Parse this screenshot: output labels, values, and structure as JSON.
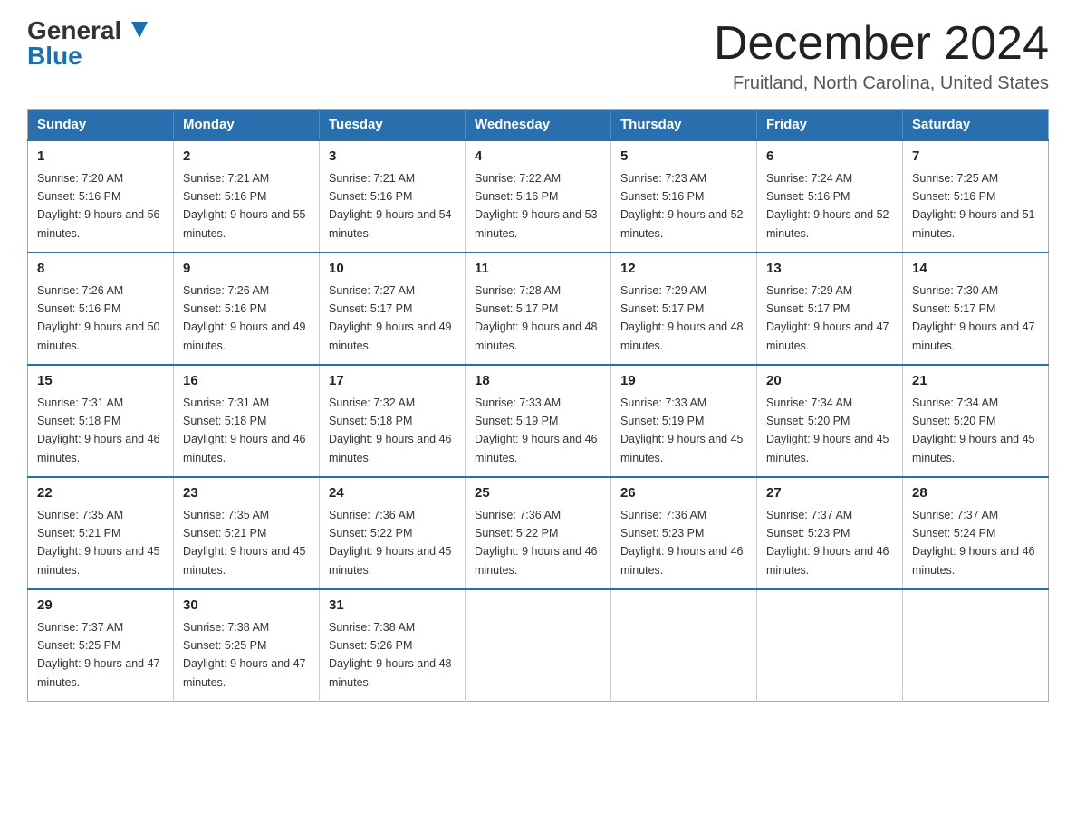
{
  "header": {
    "logo": {
      "general": "General",
      "blue": "Blue",
      "arrow": true
    },
    "title": "December 2024",
    "subtitle": "Fruitland, North Carolina, United States"
  },
  "calendar": {
    "days_of_week": [
      "Sunday",
      "Monday",
      "Tuesday",
      "Wednesday",
      "Thursday",
      "Friday",
      "Saturday"
    ],
    "weeks": [
      [
        {
          "day": "1",
          "sunrise": "7:20 AM",
          "sunset": "5:16 PM",
          "daylight": "9 hours and 56 minutes."
        },
        {
          "day": "2",
          "sunrise": "7:21 AM",
          "sunset": "5:16 PM",
          "daylight": "9 hours and 55 minutes."
        },
        {
          "day": "3",
          "sunrise": "7:21 AM",
          "sunset": "5:16 PM",
          "daylight": "9 hours and 54 minutes."
        },
        {
          "day": "4",
          "sunrise": "7:22 AM",
          "sunset": "5:16 PM",
          "daylight": "9 hours and 53 minutes."
        },
        {
          "day": "5",
          "sunrise": "7:23 AM",
          "sunset": "5:16 PM",
          "daylight": "9 hours and 52 minutes."
        },
        {
          "day": "6",
          "sunrise": "7:24 AM",
          "sunset": "5:16 PM",
          "daylight": "9 hours and 52 minutes."
        },
        {
          "day": "7",
          "sunrise": "7:25 AM",
          "sunset": "5:16 PM",
          "daylight": "9 hours and 51 minutes."
        }
      ],
      [
        {
          "day": "8",
          "sunrise": "7:26 AM",
          "sunset": "5:16 PM",
          "daylight": "9 hours and 50 minutes."
        },
        {
          "day": "9",
          "sunrise": "7:26 AM",
          "sunset": "5:16 PM",
          "daylight": "9 hours and 49 minutes."
        },
        {
          "day": "10",
          "sunrise": "7:27 AM",
          "sunset": "5:17 PM",
          "daylight": "9 hours and 49 minutes."
        },
        {
          "day": "11",
          "sunrise": "7:28 AM",
          "sunset": "5:17 PM",
          "daylight": "9 hours and 48 minutes."
        },
        {
          "day": "12",
          "sunrise": "7:29 AM",
          "sunset": "5:17 PM",
          "daylight": "9 hours and 48 minutes."
        },
        {
          "day": "13",
          "sunrise": "7:29 AM",
          "sunset": "5:17 PM",
          "daylight": "9 hours and 47 minutes."
        },
        {
          "day": "14",
          "sunrise": "7:30 AM",
          "sunset": "5:17 PM",
          "daylight": "9 hours and 47 minutes."
        }
      ],
      [
        {
          "day": "15",
          "sunrise": "7:31 AM",
          "sunset": "5:18 PM",
          "daylight": "9 hours and 46 minutes."
        },
        {
          "day": "16",
          "sunrise": "7:31 AM",
          "sunset": "5:18 PM",
          "daylight": "9 hours and 46 minutes."
        },
        {
          "day": "17",
          "sunrise": "7:32 AM",
          "sunset": "5:18 PM",
          "daylight": "9 hours and 46 minutes."
        },
        {
          "day": "18",
          "sunrise": "7:33 AM",
          "sunset": "5:19 PM",
          "daylight": "9 hours and 46 minutes."
        },
        {
          "day": "19",
          "sunrise": "7:33 AM",
          "sunset": "5:19 PM",
          "daylight": "9 hours and 45 minutes."
        },
        {
          "day": "20",
          "sunrise": "7:34 AM",
          "sunset": "5:20 PM",
          "daylight": "9 hours and 45 minutes."
        },
        {
          "day": "21",
          "sunrise": "7:34 AM",
          "sunset": "5:20 PM",
          "daylight": "9 hours and 45 minutes."
        }
      ],
      [
        {
          "day": "22",
          "sunrise": "7:35 AM",
          "sunset": "5:21 PM",
          "daylight": "9 hours and 45 minutes."
        },
        {
          "day": "23",
          "sunrise": "7:35 AM",
          "sunset": "5:21 PM",
          "daylight": "9 hours and 45 minutes."
        },
        {
          "day": "24",
          "sunrise": "7:36 AM",
          "sunset": "5:22 PM",
          "daylight": "9 hours and 45 minutes."
        },
        {
          "day": "25",
          "sunrise": "7:36 AM",
          "sunset": "5:22 PM",
          "daylight": "9 hours and 46 minutes."
        },
        {
          "day": "26",
          "sunrise": "7:36 AM",
          "sunset": "5:23 PM",
          "daylight": "9 hours and 46 minutes."
        },
        {
          "day": "27",
          "sunrise": "7:37 AM",
          "sunset": "5:23 PM",
          "daylight": "9 hours and 46 minutes."
        },
        {
          "day": "28",
          "sunrise": "7:37 AM",
          "sunset": "5:24 PM",
          "daylight": "9 hours and 46 minutes."
        }
      ],
      [
        {
          "day": "29",
          "sunrise": "7:37 AM",
          "sunset": "5:25 PM",
          "daylight": "9 hours and 47 minutes."
        },
        {
          "day": "30",
          "sunrise": "7:38 AM",
          "sunset": "5:25 PM",
          "daylight": "9 hours and 47 minutes."
        },
        {
          "day": "31",
          "sunrise": "7:38 AM",
          "sunset": "5:26 PM",
          "daylight": "9 hours and 48 minutes."
        },
        null,
        null,
        null,
        null
      ]
    ],
    "labels": {
      "sunrise": "Sunrise:",
      "sunset": "Sunset:",
      "daylight": "Daylight:"
    }
  }
}
